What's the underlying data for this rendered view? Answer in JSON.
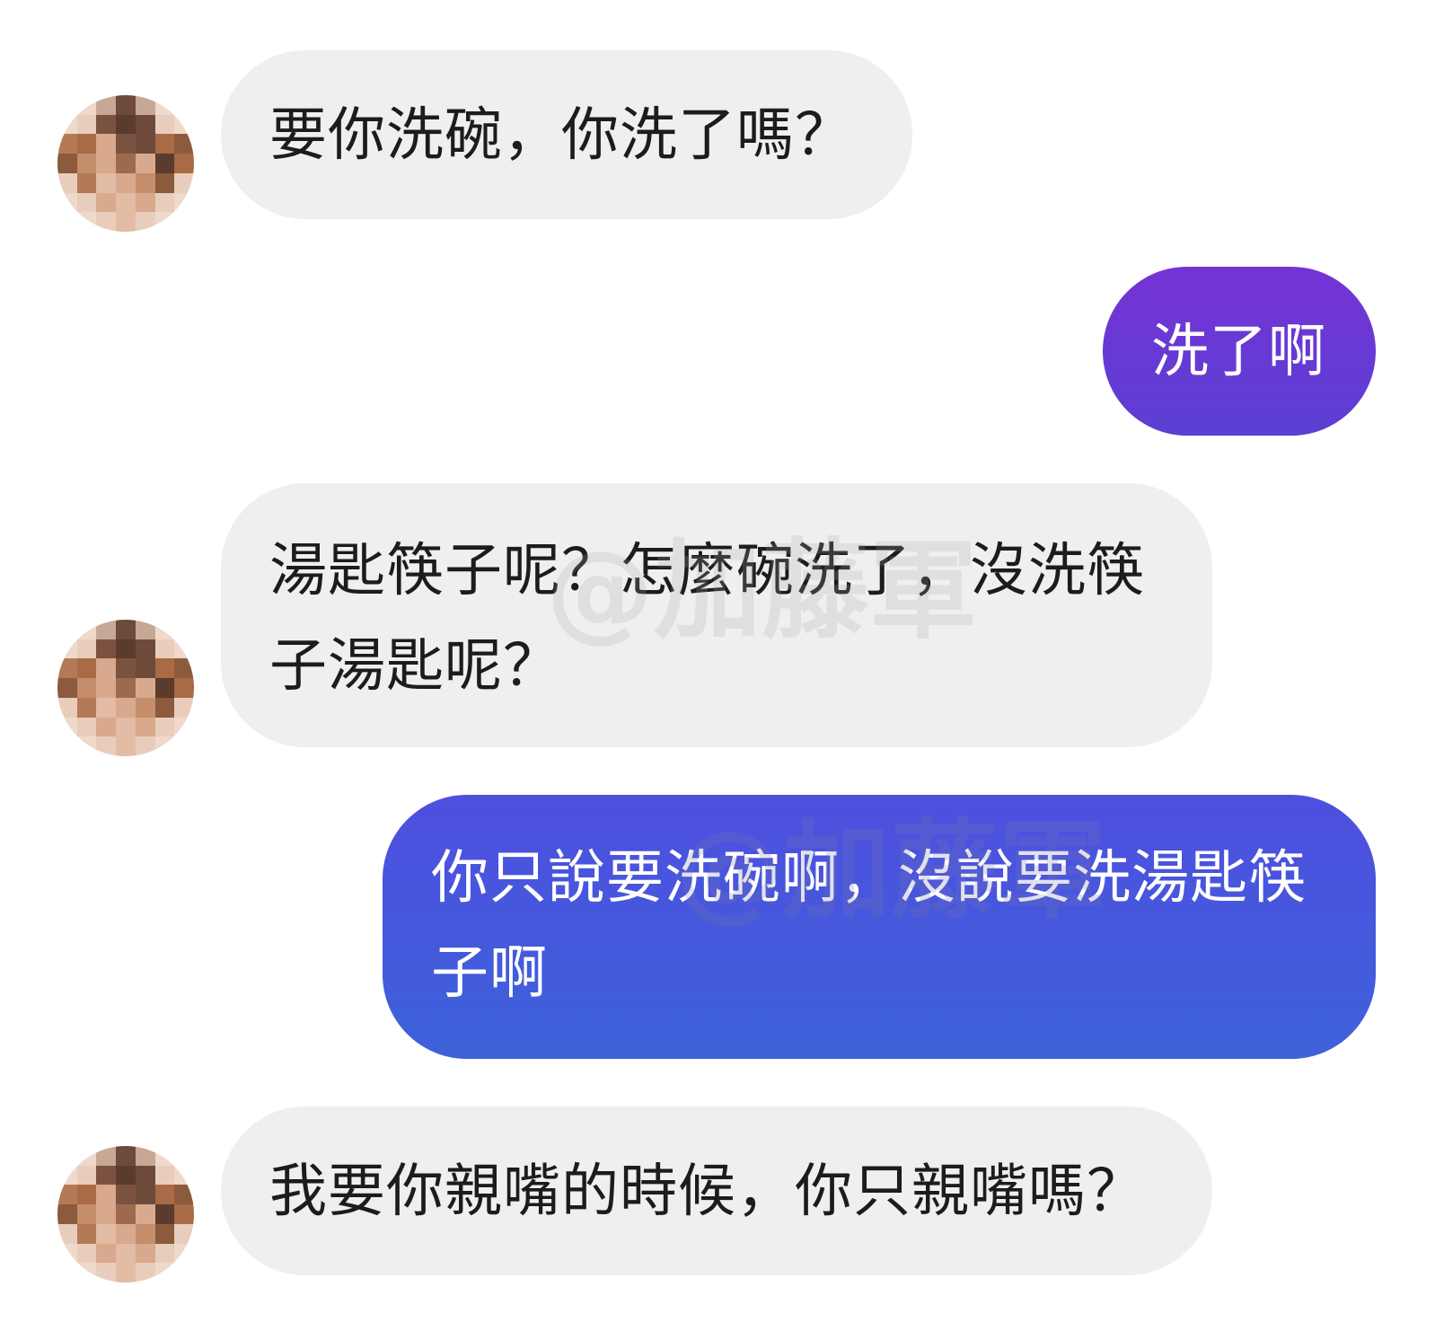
{
  "messages": [
    {
      "sender": "other",
      "text": "要你洗碗，你洗了嗎？"
    },
    {
      "sender": "self",
      "text": "洗了啊"
    },
    {
      "sender": "other",
      "text": "湯匙筷子呢？怎麼碗洗了，沒洗筷子湯匙呢？"
    },
    {
      "sender": "self",
      "text": "你只說要洗碗啊，沒說要洗湯匙筷子啊"
    },
    {
      "sender": "other",
      "text": "我要你親嘴的時候，你只親嘴嗎？"
    }
  ],
  "watermark": "@加藤軍",
  "colors": {
    "incoming_bubble": "#efefef",
    "outgoing_bubble_purple": "#6a38d4",
    "outgoing_bubble_blue": "#4559dd",
    "incoming_text": "#1c1c1c",
    "outgoing_text": "#ffffff"
  },
  "icons": {
    "contact_avatar": "avatar-icon"
  }
}
